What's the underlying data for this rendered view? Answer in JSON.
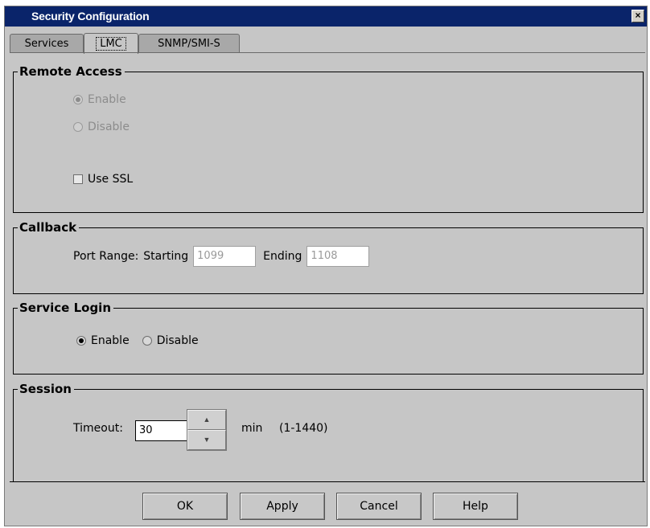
{
  "window": {
    "title": "Security Configuration",
    "close_glyph": "×"
  },
  "tabs": [
    {
      "label": "Services",
      "active": false
    },
    {
      "label": "LMC",
      "active": true
    },
    {
      "label": "SNMP/SMI-S",
      "active": false
    }
  ],
  "remote_access": {
    "legend": "Remote Access",
    "enable_label": "Enable",
    "disable_label": "Disable",
    "selected": "Enable",
    "enabled": false,
    "use_ssl_label": "Use SSL",
    "use_ssl_checked": false
  },
  "callback": {
    "legend": "Callback",
    "port_range_label": "Port Range:",
    "starting_label": "Starting",
    "starting_value": "1099",
    "ending_label": "Ending",
    "ending_value": "1108"
  },
  "service_login": {
    "legend": "Service Login",
    "enable_label": "Enable",
    "disable_label": "Disable",
    "selected": "Enable"
  },
  "session": {
    "legend": "Session",
    "timeout_label": "Timeout:",
    "timeout_value": "30",
    "unit_label": "min",
    "range_label": "(1-1440)",
    "up_glyph": "▲",
    "down_glyph": "▼"
  },
  "buttons": {
    "ok": "OK",
    "apply": "Apply",
    "cancel": "Cancel",
    "help": "Help"
  },
  "colors": {
    "titlebar": "#0a246a",
    "dialog_bg": "#c6c6c6",
    "disabled_text": "#8c8c8c"
  }
}
